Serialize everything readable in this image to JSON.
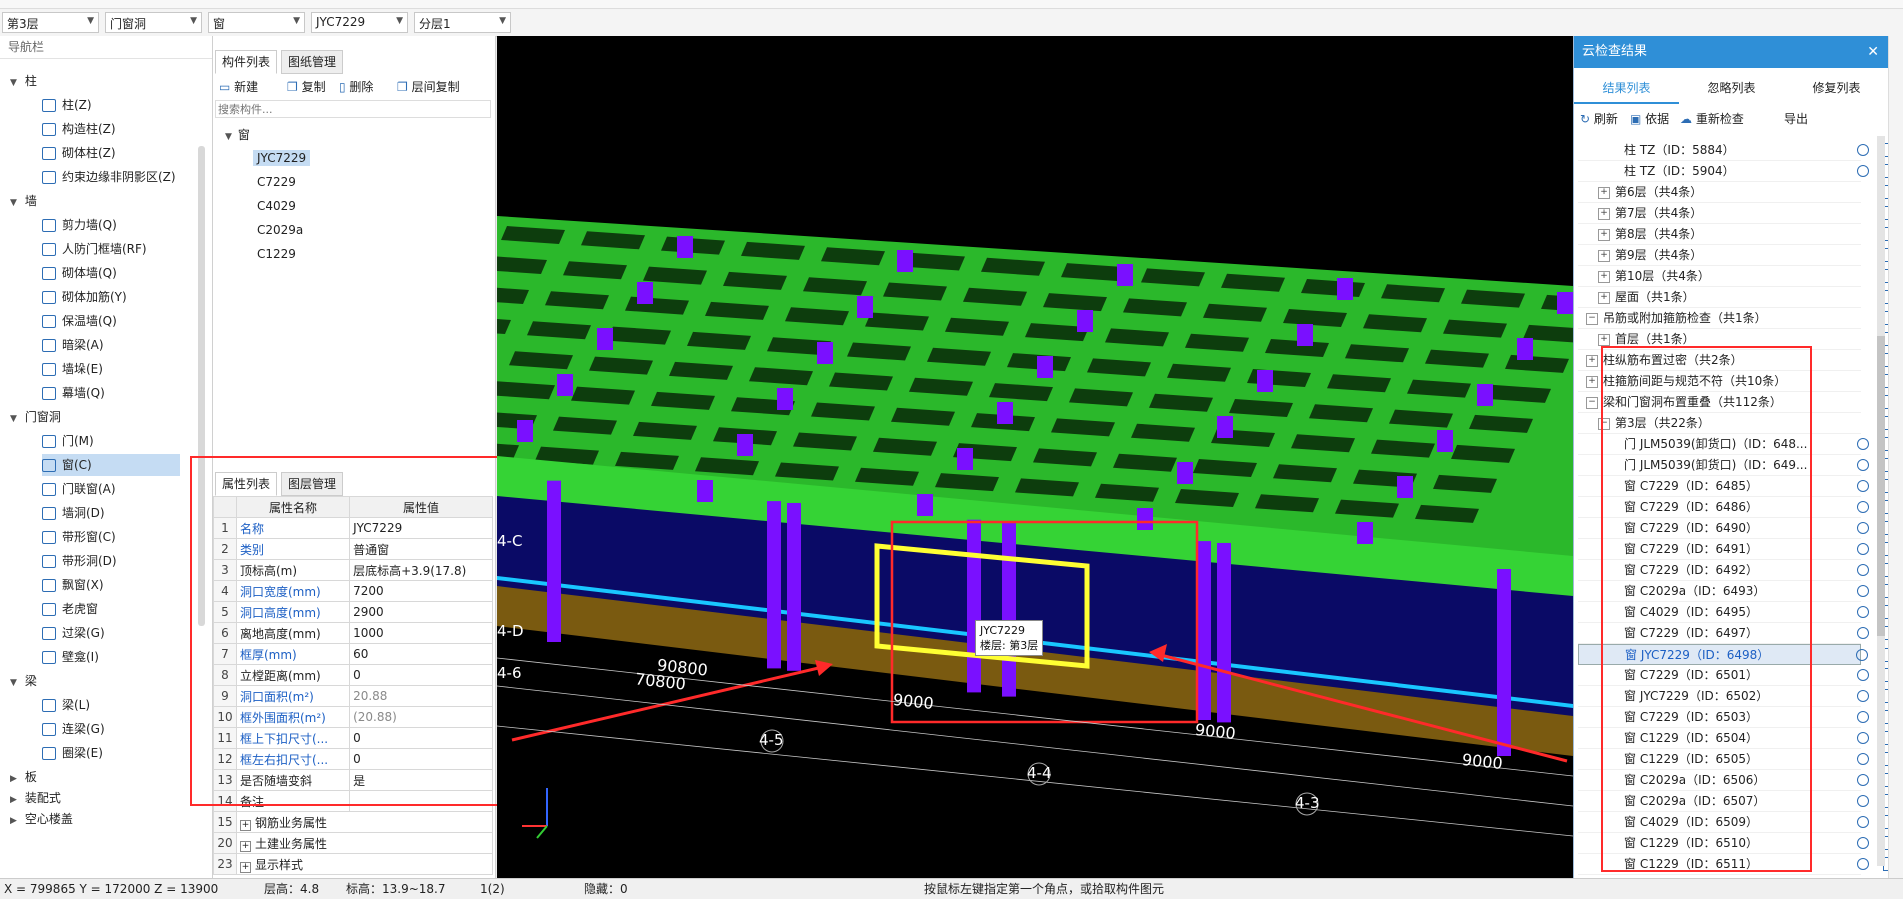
{
  "toolbar": {
    "floor_select": "第3层",
    "category_select": "门窗洞",
    "type_select": "窗",
    "component_select": "JYC7229",
    "layer_select": "分层1"
  },
  "nav": {
    "title": "导航栏",
    "groups": [
      {
        "label": "柱",
        "items": [
          "柱(Z)",
          "构造柱(Z)",
          "砌体柱(Z)",
          "约束边缘非阴影区(Z)"
        ]
      },
      {
        "label": "墙",
        "items": [
          "剪力墙(Q)",
          "人防门框墙(RF)",
          "砌体墙(Q)",
          "砌体加筋(Y)",
          "保温墙(Q)",
          "暗梁(A)",
          "墙垛(E)",
          "幕墙(Q)"
        ]
      },
      {
        "label": "门窗洞",
        "items": [
          "门(M)",
          "窗(C)",
          "门联窗(A)",
          "墙洞(D)",
          "带形窗(C)",
          "带形洞(D)",
          "飘窗(X)",
          "老虎窗",
          "过梁(G)",
          "壁龛(I)"
        ]
      },
      {
        "label": "梁",
        "items": [
          "梁(L)",
          "连梁(G)",
          "圈梁(E)"
        ]
      }
    ],
    "tail": [
      "板",
      "装配式",
      "空心楼盖"
    ]
  },
  "components": {
    "tabs": [
      "构件列表",
      "图纸管理"
    ],
    "actions": [
      "新建",
      "复制",
      "删除",
      "层间复制"
    ],
    "search_placeholder": "搜索构件...",
    "group": "窗",
    "items": [
      "JYC7229",
      "C7229",
      "C4029",
      "C2029a",
      "C1229"
    ]
  },
  "properties": {
    "tabs": [
      "属性列表",
      "图层管理"
    ],
    "col_name": "属性名称",
    "col_value": "属性值",
    "rows": [
      {
        "i": "1",
        "name": "名称",
        "value": "JYC7229"
      },
      {
        "i": "2",
        "name": "类别",
        "value": "普通窗"
      },
      {
        "i": "3",
        "name": "顶标高(m)",
        "value": "层底标高+3.9(17.8)"
      },
      {
        "i": "4",
        "name": "洞口宽度(mm)",
        "value": "7200"
      },
      {
        "i": "5",
        "name": "洞口高度(mm)",
        "value": "2900"
      },
      {
        "i": "6",
        "name": "离地高度(mm)",
        "value": "1000"
      },
      {
        "i": "7",
        "name": "框厚(mm)",
        "value": "60"
      },
      {
        "i": "8",
        "name": "立樘距离(mm)",
        "value": "0"
      },
      {
        "i": "9",
        "name": "洞口面积(m²)",
        "value": "20.88"
      },
      {
        "i": "10",
        "name": "框外围面积(m²)",
        "value": "(20.88)"
      },
      {
        "i": "11",
        "name": "框上下扣尺寸(...",
        "value": "0"
      },
      {
        "i": "12",
        "name": "框左右扣尺寸(...",
        "value": "0"
      },
      {
        "i": "13",
        "name": "是否随墙变斜",
        "value": "是"
      },
      {
        "i": "14",
        "name": "备注",
        "value": ""
      },
      {
        "i": "15",
        "name": "钢筋业务属性",
        "value": ""
      },
      {
        "i": "20",
        "name": "土建业务属性",
        "value": ""
      },
      {
        "i": "23",
        "name": "显示样式",
        "value": ""
      }
    ]
  },
  "view": {
    "axes": [
      "4-C",
      "4-D",
      "4-6",
      "4-5",
      "4-4",
      "4-3"
    ],
    "dims": [
      "90800",
      "70800",
      "9000",
      "9000",
      "9000"
    ],
    "tooltip_name": "JYC7229",
    "tooltip_floor": "楼层: 第3层"
  },
  "cloud": {
    "title": "云检查结果",
    "tabs": [
      "结果列表",
      "忽略列表",
      "修复列表"
    ],
    "actions": [
      "刷新",
      "依据",
      "重新检查",
      "导出"
    ],
    "rows": [
      {
        "t": "柱 TZ（ID：5884）",
        "lvl": 3,
        "loc": true
      },
      {
        "t": "柱 TZ（ID：5904）",
        "lvl": 3,
        "loc": true
      },
      {
        "t": "第6层（共4条）",
        "lvl": 2,
        "plus": "+"
      },
      {
        "t": "第7层（共4条）",
        "lvl": 2,
        "plus": "+"
      },
      {
        "t": "第8层（共4条）",
        "lvl": 2,
        "plus": "+"
      },
      {
        "t": "第9层（共4条）",
        "lvl": 2,
        "plus": "+"
      },
      {
        "t": "第10层（共4条）",
        "lvl": 2,
        "plus": "+"
      },
      {
        "t": "屋面（共1条）",
        "lvl": 2,
        "plus": "+"
      },
      {
        "t": "吊筋或附加箍筋检查（共1条）",
        "lvl": 1,
        "plus": "−"
      },
      {
        "t": "首层（共1条）",
        "lvl": 2,
        "plus": "+"
      },
      {
        "t": "柱纵筋布置过密（共2条）",
        "lvl": 1,
        "plus": "+"
      },
      {
        "t": "柱箍筋间距与规范不符（共10条）",
        "lvl": 1,
        "plus": "+"
      },
      {
        "t": "梁和门窗洞布置重叠（共112条）",
        "lvl": 1,
        "plus": "−"
      },
      {
        "t": "第3层（共22条）",
        "lvl": 2,
        "plus": "−"
      },
      {
        "t": "门 JLM5039(卸货口)（ID：648...",
        "lvl": 3,
        "loc": true
      },
      {
        "t": "门 JLM5039(卸货口)（ID：649...",
        "lvl": 3,
        "loc": true
      },
      {
        "t": "窗 C7229（ID：6485）",
        "lvl": 3,
        "loc": true
      },
      {
        "t": "窗 C7229（ID：6486）",
        "lvl": 3,
        "loc": true
      },
      {
        "t": "窗 C7229（ID：6490）",
        "lvl": 3,
        "loc": true
      },
      {
        "t": "窗 C7229（ID：6491）",
        "lvl": 3,
        "loc": true
      },
      {
        "t": "窗 C7229（ID：6492）",
        "lvl": 3,
        "loc": true
      },
      {
        "t": "窗 C2029a（ID：6493）",
        "lvl": 3,
        "loc": true
      },
      {
        "t": "窗 C4029（ID：6495）",
        "lvl": 3,
        "loc": true
      },
      {
        "t": "窗 C7229（ID：6497）",
        "lvl": 3,
        "loc": true
      },
      {
        "t": "窗 JYC7229（ID：6498）",
        "lvl": 3,
        "loc": true,
        "hl": true
      },
      {
        "t": "窗 C7229（ID：6501）",
        "lvl": 3,
        "loc": true
      },
      {
        "t": "窗 JYC7229（ID：6502）",
        "lvl": 3,
        "loc": true
      },
      {
        "t": "窗 C7229（ID：6503）",
        "lvl": 3,
        "loc": true
      },
      {
        "t": "窗 C1229（ID：6504）",
        "lvl": 3,
        "loc": true
      },
      {
        "t": "窗 C1229（ID：6505）",
        "lvl": 3,
        "loc": true
      },
      {
        "t": "窗 C2029a（ID：6506）",
        "lvl": 3,
        "loc": true
      },
      {
        "t": "窗 C2029a（ID：6507）",
        "lvl": 3,
        "loc": true
      },
      {
        "t": "窗 C4029（ID：6509）",
        "lvl": 3,
        "loc": true
      },
      {
        "t": "窗 C1229（ID：6510）",
        "lvl": 3,
        "loc": true
      },
      {
        "t": "窗 C1229（ID：6511）",
        "lvl": 3,
        "loc": true
      }
    ]
  },
  "status": {
    "coords": "X = 799865 Y = 172000 Z = 13900",
    "floor_height": "层高：4.8",
    "elevation": "标高：13.9~18.7",
    "count": "1(2)",
    "hidden": "隐藏：0",
    "hint": "按鼠标左键指定第一个角点，或拾取构件图元"
  },
  "colors": {
    "accent": "#2f8fd7",
    "highlight_red": "#ff2a2a",
    "beam_green": "#35d335",
    "column_purple": "#7a10ff",
    "selection_yellow": "#ffff33"
  }
}
